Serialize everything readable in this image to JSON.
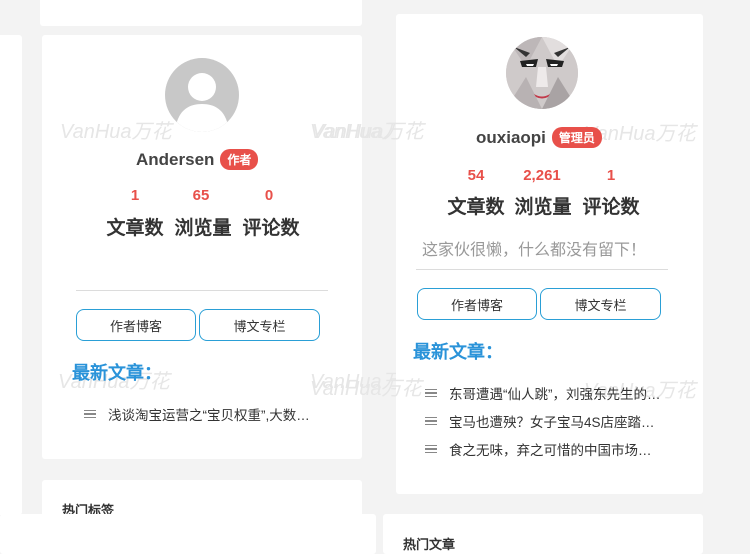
{
  "watermark": "VanHua万花",
  "left_profile": {
    "username": "Andersen",
    "badge": "作者",
    "stats": [
      {
        "value": "1",
        "label": "文章数"
      },
      {
        "value": "65",
        "label": "浏览量"
      },
      {
        "value": "0",
        "label": "评论数"
      }
    ],
    "buttons": [
      "作者博客",
      "博文专栏"
    ],
    "section_title": "最新文章：",
    "articles": [
      "浅谈淘宝运营之“宝贝权重”,大数…"
    ],
    "next_card_title": "热门标签"
  },
  "right_profile": {
    "username": "ouxiaopi",
    "badge": "管理员",
    "stats": [
      {
        "value": "54",
        "label": "文章数"
      },
      {
        "value": "2,261",
        "label": "浏览量"
      },
      {
        "value": "1",
        "label": "评论数"
      }
    ],
    "bio": "这家伙很懒，什么都没有留下！",
    "buttons": [
      "作者博客",
      "博文专栏"
    ],
    "section_title": "最新文章：",
    "articles": [
      "东哥遭遇“仙人跳”，刘强东先生的…",
      "宝马也遭殃？女子宝马4S店座踏…",
      "食之无味，弃之可惜的中国市场…"
    ],
    "next_card_title": "热门文章"
  },
  "colors": {
    "accent": "#2a93d9",
    "badge": "#e8504a",
    "number": "#e8504a"
  }
}
